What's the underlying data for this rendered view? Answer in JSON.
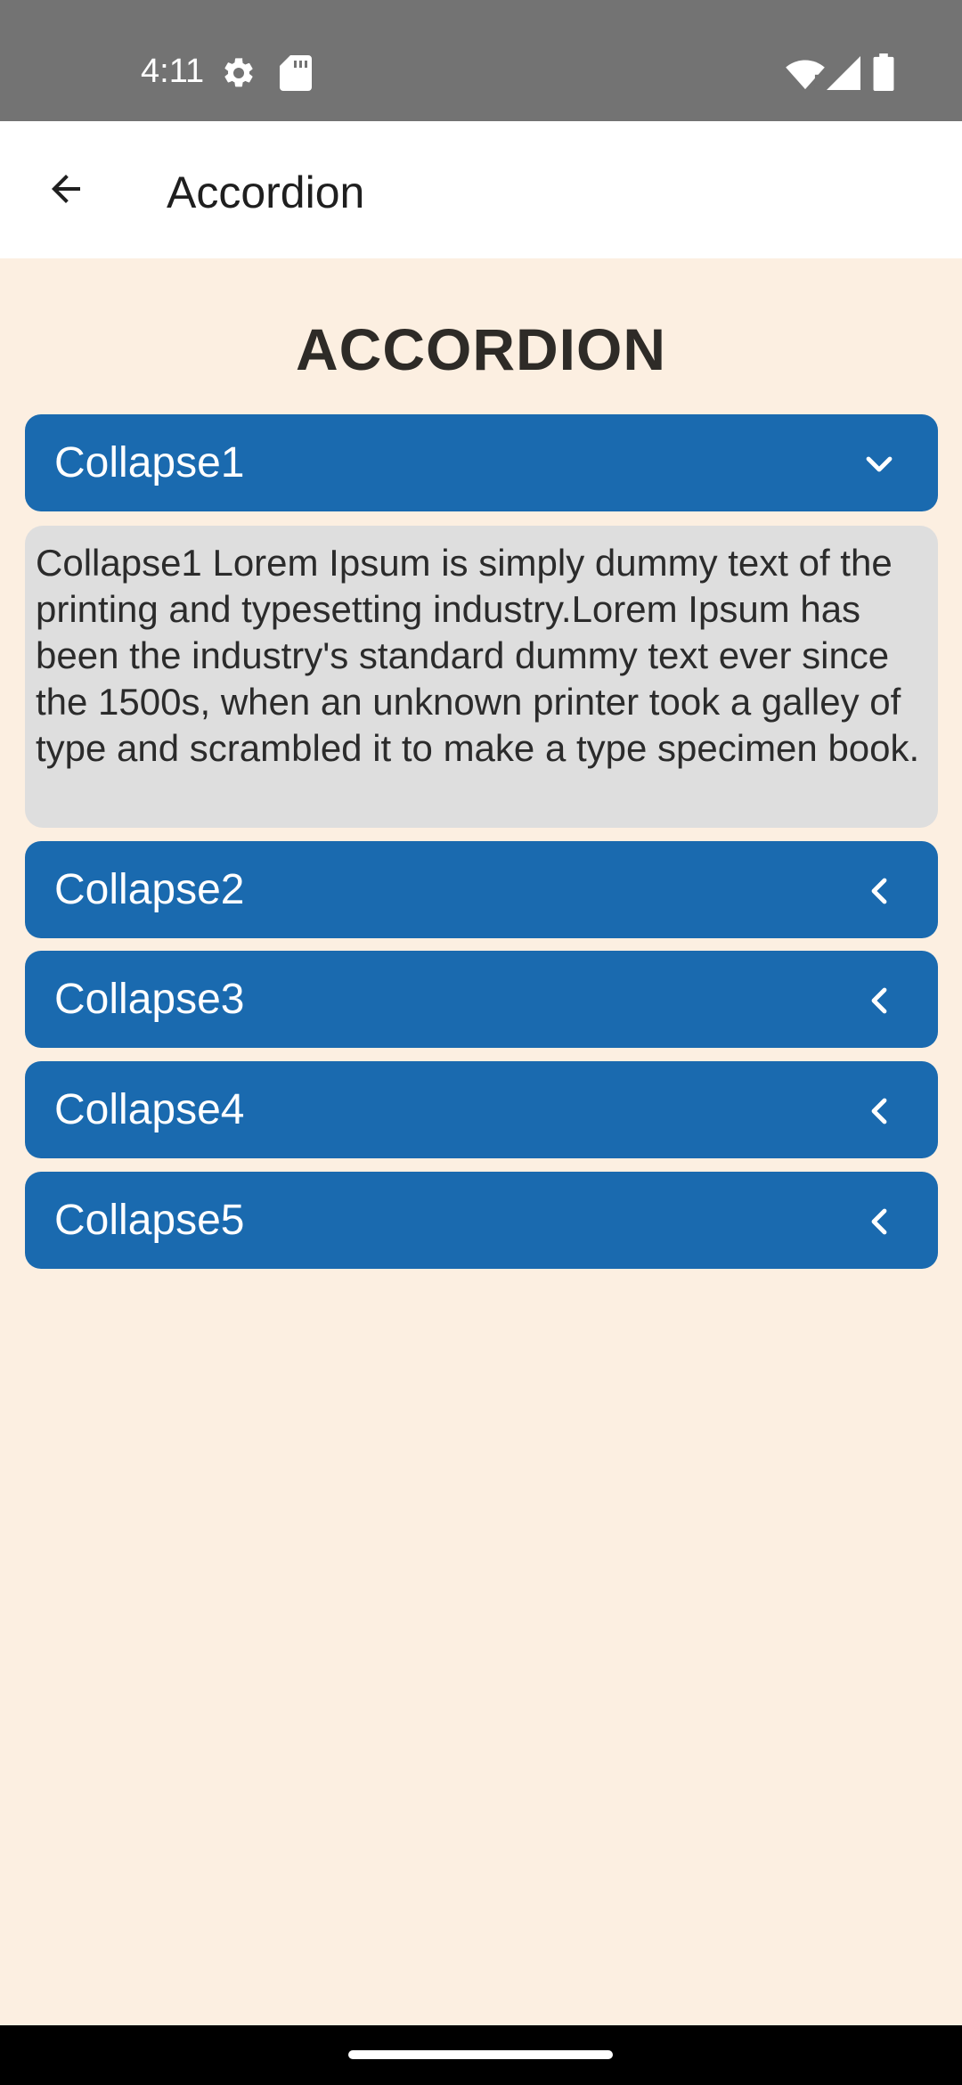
{
  "status_bar": {
    "time": "4:11",
    "icons": [
      "settings-icon",
      "sd-card-icon",
      "wifi-icon",
      "signal-icon",
      "battery-icon"
    ]
  },
  "app_bar": {
    "back_icon": "arrow-back-icon",
    "title": "Accordion"
  },
  "page": {
    "heading": "ACCORDION"
  },
  "accordion": {
    "items": [
      {
        "label": "Collapse1",
        "expanded": true,
        "chevron": "chevron-down-icon",
        "content": "Collapse1 Lorem Ipsum is simply dummy text of the printing and typesetting industry.Lorem Ipsum has been the industry's standard dummy text ever since the 1500s, when an unknown printer took a galley of type and scrambled it to make a type specimen book."
      },
      {
        "label": "Collapse2",
        "expanded": false,
        "chevron": "chevron-left-icon"
      },
      {
        "label": "Collapse3",
        "expanded": false,
        "chevron": "chevron-left-icon"
      },
      {
        "label": "Collapse4",
        "expanded": false,
        "chevron": "chevron-left-icon"
      },
      {
        "label": "Collapse5",
        "expanded": false,
        "chevron": "chevron-left-icon"
      }
    ]
  },
  "colors": {
    "page_background": "#FCEFE1",
    "accordion_header": "#1A6AAF",
    "accordion_body": "#DEDEDE",
    "status_bar": "#737373"
  }
}
